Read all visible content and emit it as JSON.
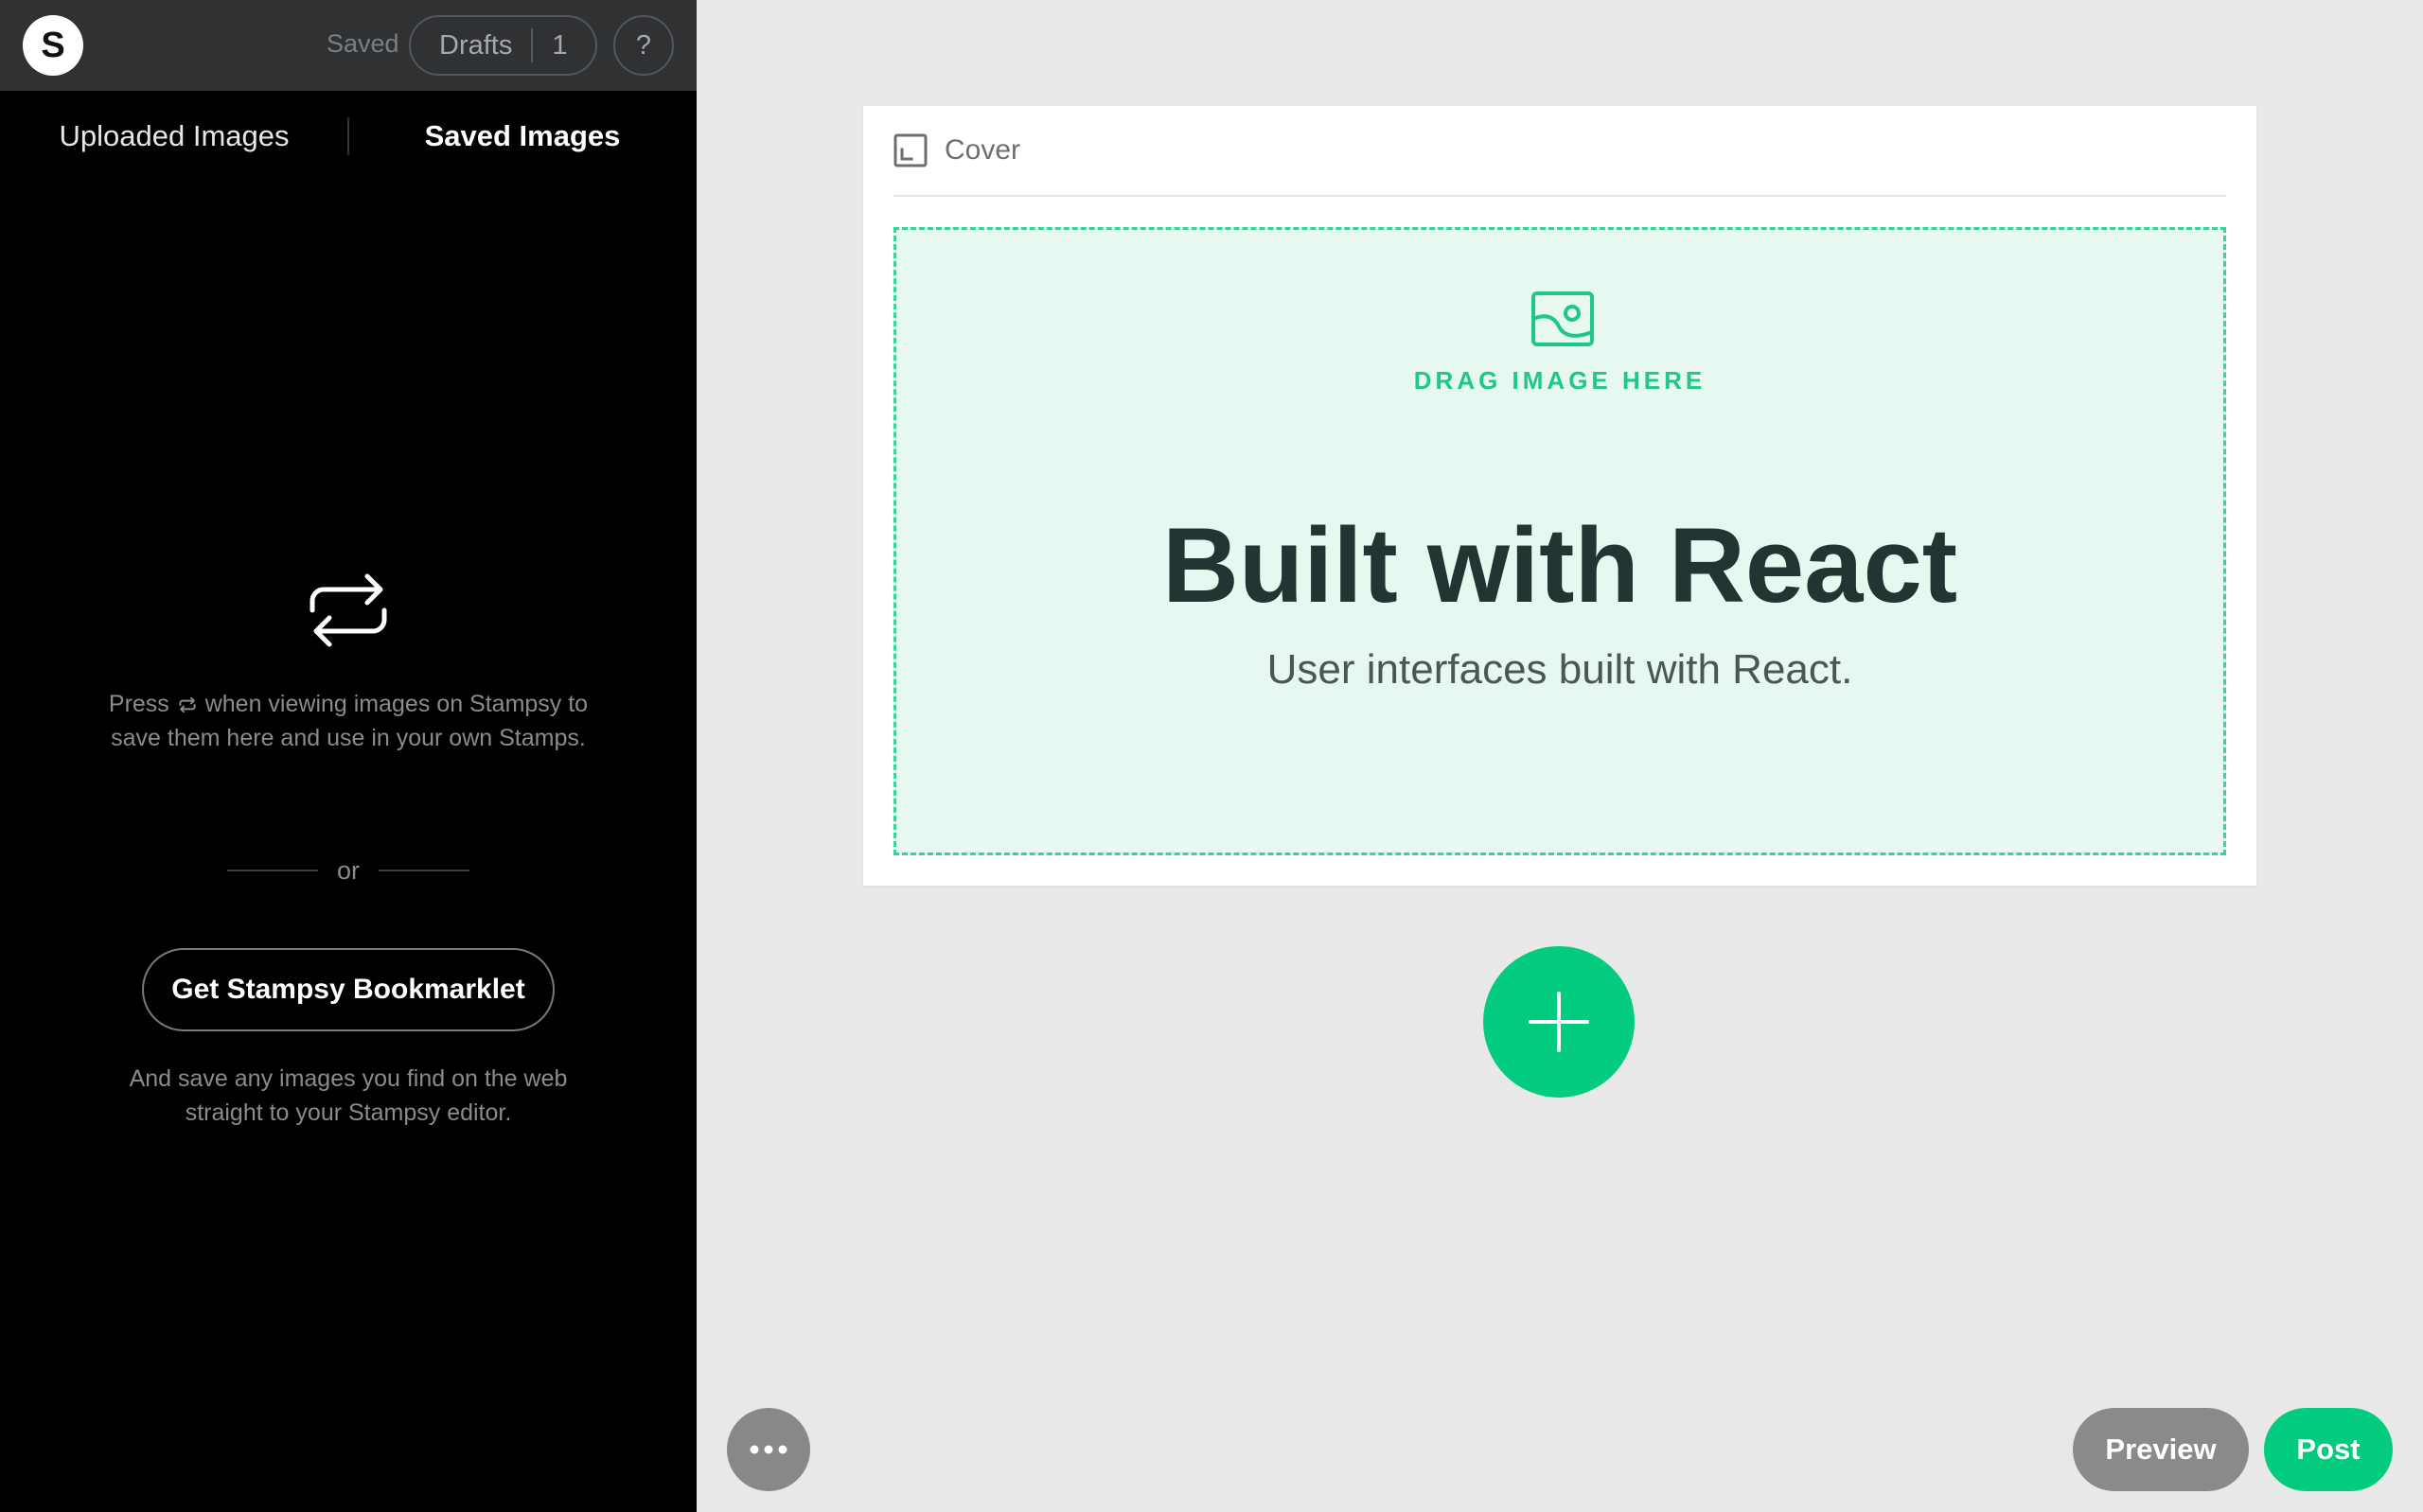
{
  "app": {
    "logo_letter": "S"
  },
  "topbar": {
    "saved_label": "Saved",
    "drafts_label": "Drafts",
    "drafts_count": "1",
    "help_label": "?"
  },
  "sidebar": {
    "tabs": [
      {
        "label": "Uploaded Images",
        "active": false
      },
      {
        "label": "Saved Images",
        "active": true
      }
    ],
    "hint_press": "Press",
    "hint_rest": "when viewing images on Stampsy to save them here and use in your own Stamps.",
    "or_label": "or",
    "bookmarklet_label": "Get Stampsy Bookmarklet",
    "save_hint": "And save any images you find on the web straight to your Stampsy editor."
  },
  "editor": {
    "cover_label": "Cover",
    "drop_label": "DRAG IMAGE HERE",
    "title": "Built with React",
    "subtitle": "User interfaces built with React."
  },
  "footer": {
    "preview_label": "Preview",
    "post_label": "Post"
  },
  "colors": {
    "accent": "#04cc7e",
    "sidebar_bg": "#000000",
    "topbar_bg": "#2f3133",
    "canvas_bg": "#e8e8e8",
    "dropzone_bg": "#e6f8ef",
    "dropzone_border": "#38d39b"
  },
  "icons": [
    "repeat-icon",
    "cover-icon",
    "image-icon",
    "plus-icon",
    "more-icon"
  ]
}
